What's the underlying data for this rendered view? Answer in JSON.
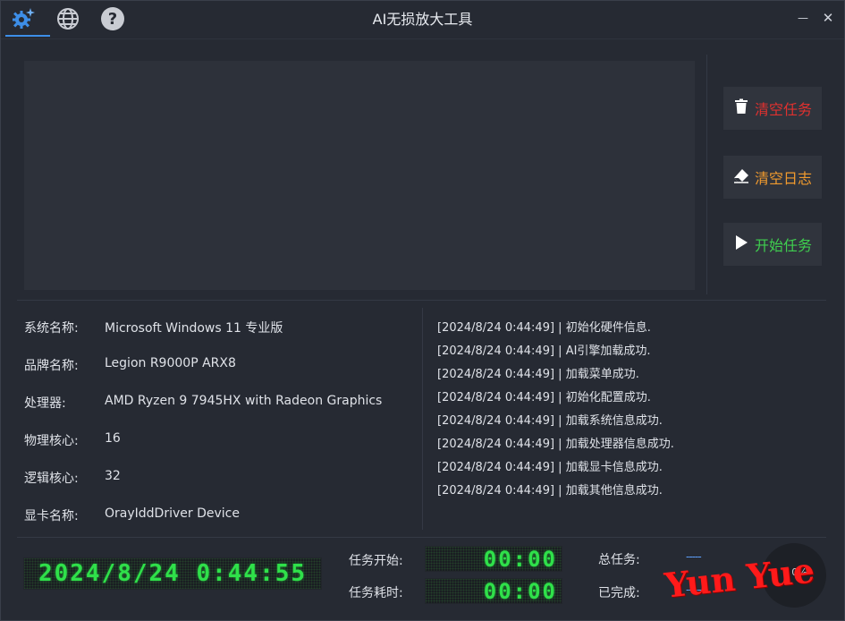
{
  "window": {
    "title": "AI无损放大工具",
    "minimize": "—",
    "close": "✕"
  },
  "toolbar": {
    "icons": [
      "settings-sparkle-icon",
      "globe-icon",
      "help-icon"
    ]
  },
  "actions": {
    "clear_tasks": "清空任务",
    "clear_log": "清空日志",
    "start_task": "开始任务",
    "colors": {
      "clear_tasks": "#e0312f",
      "clear_log": "#f09a2e",
      "start_task": "#3fcf4f"
    }
  },
  "system_info": [
    {
      "label": "系统名称:",
      "value": "Microsoft Windows 11 专业版"
    },
    {
      "label": "品牌名称:",
      "value": "Legion R9000P ARX8"
    },
    {
      "label": "处理器:",
      "value": "AMD Ryzen 9 7945HX with Radeon Graphics"
    },
    {
      "label": "物理核心:",
      "value": "16"
    },
    {
      "label": "逻辑核心:",
      "value": "32"
    },
    {
      "label": "显卡名称:",
      "value": "OrayIddDriver Device"
    }
  ],
  "logs": [
    "[2024/8/24 0:44:49] | 初始化硬件信息.",
    "[2024/8/24 0:44:49] | AI引擎加载成功.",
    "[2024/8/24 0:44:49] | 加载菜单成功.",
    "[2024/8/24 0:44:49] | 初始化配置成功.",
    "[2024/8/24 0:44:49] | 加载系统信息成功.",
    "[2024/8/24 0:44:49] | 加载处理器信息成功.",
    "[2024/8/24 0:44:49] | 加载显卡信息成功.",
    "[2024/8/24 0:44:49] | 加载其他信息成功."
  ],
  "status": {
    "clock": "2024/8/24 0:44:55",
    "task_start_label": "任务开始:",
    "task_start_value": "00:00",
    "task_elapsed_label": "任务耗时:",
    "task_elapsed_value": "00:00",
    "total_tasks_label": "总任务:",
    "total_tasks_value": "-----",
    "completed_label": "已完成:",
    "completed_value": "-----",
    "progress_text": "0%"
  },
  "watermark": "Yun Yue"
}
